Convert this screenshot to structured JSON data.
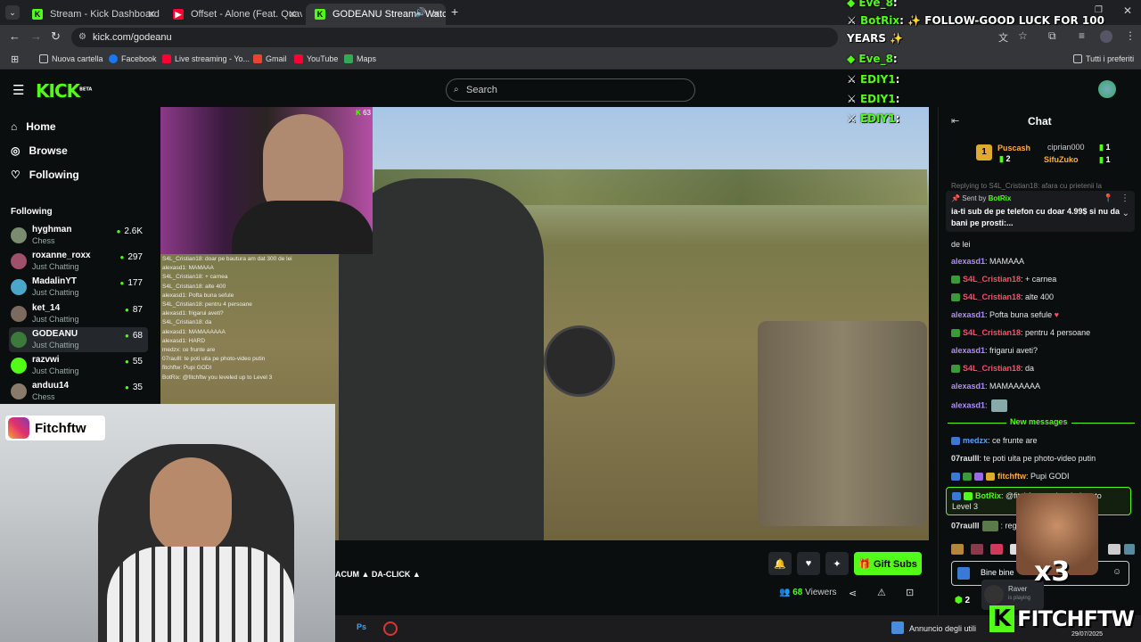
{
  "browser": {
    "tabs": [
      {
        "label": "Stream - Kick Dashboard",
        "color": "#53fc18"
      },
      {
        "label": "Offset - Alone (Feat. Quavo) (P...",
        "color": "#ff0033"
      },
      {
        "label": "GODEANU Stream - Watch...",
        "color": "#53fc18"
      }
    ],
    "new_tab": "+",
    "url": "kick.com/godeanu",
    "bookmarks": [
      "Nuova cartella",
      "Facebook",
      "Live streaming - Yo...",
      "Gmail",
      "YouTube",
      "Maps"
    ],
    "all_bookmarks": "Tutti i preferiti"
  },
  "kick": {
    "logo": "KICK",
    "logo_beta": "BETA",
    "search_placeholder": "Search",
    "nav": {
      "home": "Home",
      "browse": "Browse",
      "following": "Following"
    },
    "following_header": "Following",
    "channels": [
      {
        "name": "hyghman",
        "category": "Chess",
        "viewers": "2.6K",
        "color": "#7a8b6f"
      },
      {
        "name": "roxanne_roxx",
        "category": "Just Chatting",
        "viewers": "297",
        "color": "#a0506a"
      },
      {
        "name": "MadalinYT",
        "category": "Just Chatting",
        "viewers": "177",
        "color": "#4aa7c9"
      },
      {
        "name": "ket_14",
        "category": "Just Chatting",
        "viewers": "87",
        "color": "#7b6a5e"
      },
      {
        "name": "GODEANU",
        "category": "Just Chatting",
        "viewers": "68",
        "color": "#3b7a3b"
      },
      {
        "name": "razvwi",
        "category": "Just Chatting",
        "viewers": "55",
        "color": "#53fc18"
      },
      {
        "name": "anduu14",
        "category": "Chess",
        "viewers": "35",
        "color": "#8a7a6a"
      }
    ]
  },
  "stream": {
    "cam_viewers": "63",
    "instagram_handle": "Fitchftw",
    "ticker": "ACUM ▲ DA-CLICK ▲",
    "viewers_count": "68",
    "viewers_label": "Viewers",
    "gift_subs": "Gift Subs",
    "overlay_chat": [
      "S4L_Cristian18: doar pe bautura am dat 300 de lei",
      "alexasd1: MAMAAA",
      "S4L_Cristian18: + carnea",
      "S4L_Cristian18: alte 400",
      "alexasd1: Pofta buna sefule",
      "S4L_Cristian18: pentru 4 persoane",
      "alexasd1: frigarui aveti?",
      "S4L_Cristian18: da",
      "alexasd1: MAMAAAAAA",
      "alexasd1: HARD",
      "medzx: ce frunte are",
      "07raulll: te poti uita pe photo-video putin",
      "fitchftw: Pupi GODI",
      "BotRix: @fitchftw you leveled up to Level 3"
    ]
  },
  "stream_overlay": {
    "lines": [
      {
        "user": "Eve_8",
        "text": ":"
      },
      {
        "user": "BotRix",
        "text": ": ✨ FOLLOW-GOOD LUCK FOR 100"
      },
      {
        "user": "",
        "text": "YEARS ✨"
      },
      {
        "user": "Eve_8",
        "text": ":"
      },
      {
        "user": "EDIY1",
        "text": ":"
      },
      {
        "user": "EDIY1",
        "text": ":"
      },
      {
        "user": "EDIY1",
        "text": ":"
      }
    ],
    "brand": "FITCHFTW",
    "brand_k": "K",
    "multiplier": "x3"
  },
  "chat": {
    "title": "Chat",
    "leaderboard": [
      {
        "name": "Puscash",
        "count": "2",
        "rank": "1"
      },
      {
        "name": "ciprian000",
        "count": "1"
      },
      {
        "name": "SifuZuko",
        "count": "1"
      }
    ],
    "replying": "Replying to S4L_Cristian18: afara cu prietenii la",
    "pinned": {
      "sent_by": "Sent by",
      "user": "BotRix",
      "text": "ia-ti sub de pe telefon cu doar 4.99$ si nu da bani pe prosti:..."
    },
    "messages": [
      {
        "user": "",
        "text": "de lei",
        "color": "#e6e6e6"
      },
      {
        "user": "alexasd1",
        "text": ": MAMAAA",
        "color": "#b08cff"
      },
      {
        "user": "S4L_Cristian18",
        "text": ": + carnea",
        "color": "#ff4d6a"
      },
      {
        "user": "S4L_Cristian18",
        "text": ": alte 400",
        "color": "#ff4d6a"
      },
      {
        "user": "alexasd1",
        "text": ": Pofta buna sefule",
        "color": "#b08cff"
      },
      {
        "user": "S4L_Cristian18",
        "text": ": pentru 4 persoane",
        "color": "#ff4d6a"
      },
      {
        "user": "alexasd1",
        "text": ": frigarui aveti?",
        "color": "#b08cff"
      },
      {
        "user": "S4L_Cristian18",
        "text": ": da",
        "color": "#ff4d6a"
      },
      {
        "user": "alexasd1",
        "text": ": MAMAAAAAA",
        "color": "#b08cff"
      },
      {
        "user": "alexasd1",
        "text": ":",
        "color": "#b08cff"
      }
    ],
    "new_messages": "New messages",
    "messages2": [
      {
        "user": "medzx",
        "text": ": ce frunte are",
        "color": "#5aa0ff"
      },
      {
        "user": "07raulll",
        "text": ": te poti uita pe photo-video putin",
        "color": "#e6e6e6"
      },
      {
        "user": "fitchftw",
        "text": ": Pupi GODI",
        "color": "#ffae3d"
      }
    ],
    "botrix_msg": {
      "user": "BotRix",
      "text": ": @fitchftw you leveled up to",
      "text2": "Level 3"
    },
    "last_msg": {
      "user": "07raulll",
      "text": ": rege"
    },
    "input_value": "Bine bine",
    "input_count": "2",
    "notif_user": "Raver",
    "notif_sub": "is playing"
  },
  "taskbar": {
    "app": "Ps",
    "notice": "Annuncio degli utili",
    "date": "29/07/2025"
  }
}
